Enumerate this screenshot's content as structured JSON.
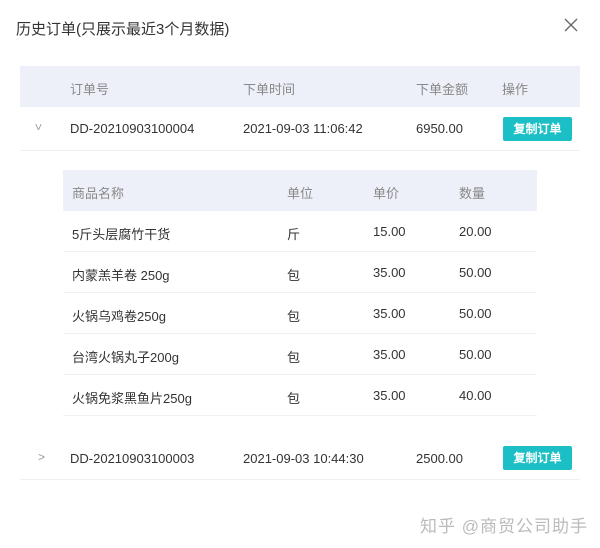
{
  "dialog": {
    "title": "历史订单(只展示最近3个月数据)"
  },
  "orders": {
    "headers": [
      "订单号",
      "下单时间",
      "下单金额",
      "操作"
    ],
    "rows": [
      {
        "id": "DD-20210903100004",
        "time": "2021-09-03 11:06:42",
        "amount": "6950.00",
        "action": "复制订单",
        "expanded": true
      },
      {
        "id": "DD-20210903100003",
        "time": "2021-09-03 10:44:30",
        "amount": "2500.00",
        "action": "复制订单",
        "expanded": false
      }
    ]
  },
  "items": {
    "headers": [
      "商品名称",
      "单位",
      "单价",
      "数量"
    ],
    "rows": [
      {
        "name": "5斤头层腐竹干货",
        "unit": "斤",
        "price": "15.00",
        "qty": "20.00"
      },
      {
        "name": "内蒙羔羊卷 250g",
        "unit": "包",
        "price": "35.00",
        "qty": "50.00"
      },
      {
        "name": "火锅乌鸡卷250g",
        "unit": "包",
        "price": "35.00",
        "qty": "50.00"
      },
      {
        "name": "台湾火锅丸子200g",
        "unit": "包",
        "price": "35.00",
        "qty": "50.00"
      },
      {
        "name": "火锅免浆黑鱼片250g",
        "unit": "包",
        "price": "35.00",
        "qty": "40.00"
      }
    ]
  },
  "watermark": "知乎 @商贸公司助手",
  "colors": {
    "accent": "#1bbfc5",
    "header_bg": "#eef0f9"
  }
}
